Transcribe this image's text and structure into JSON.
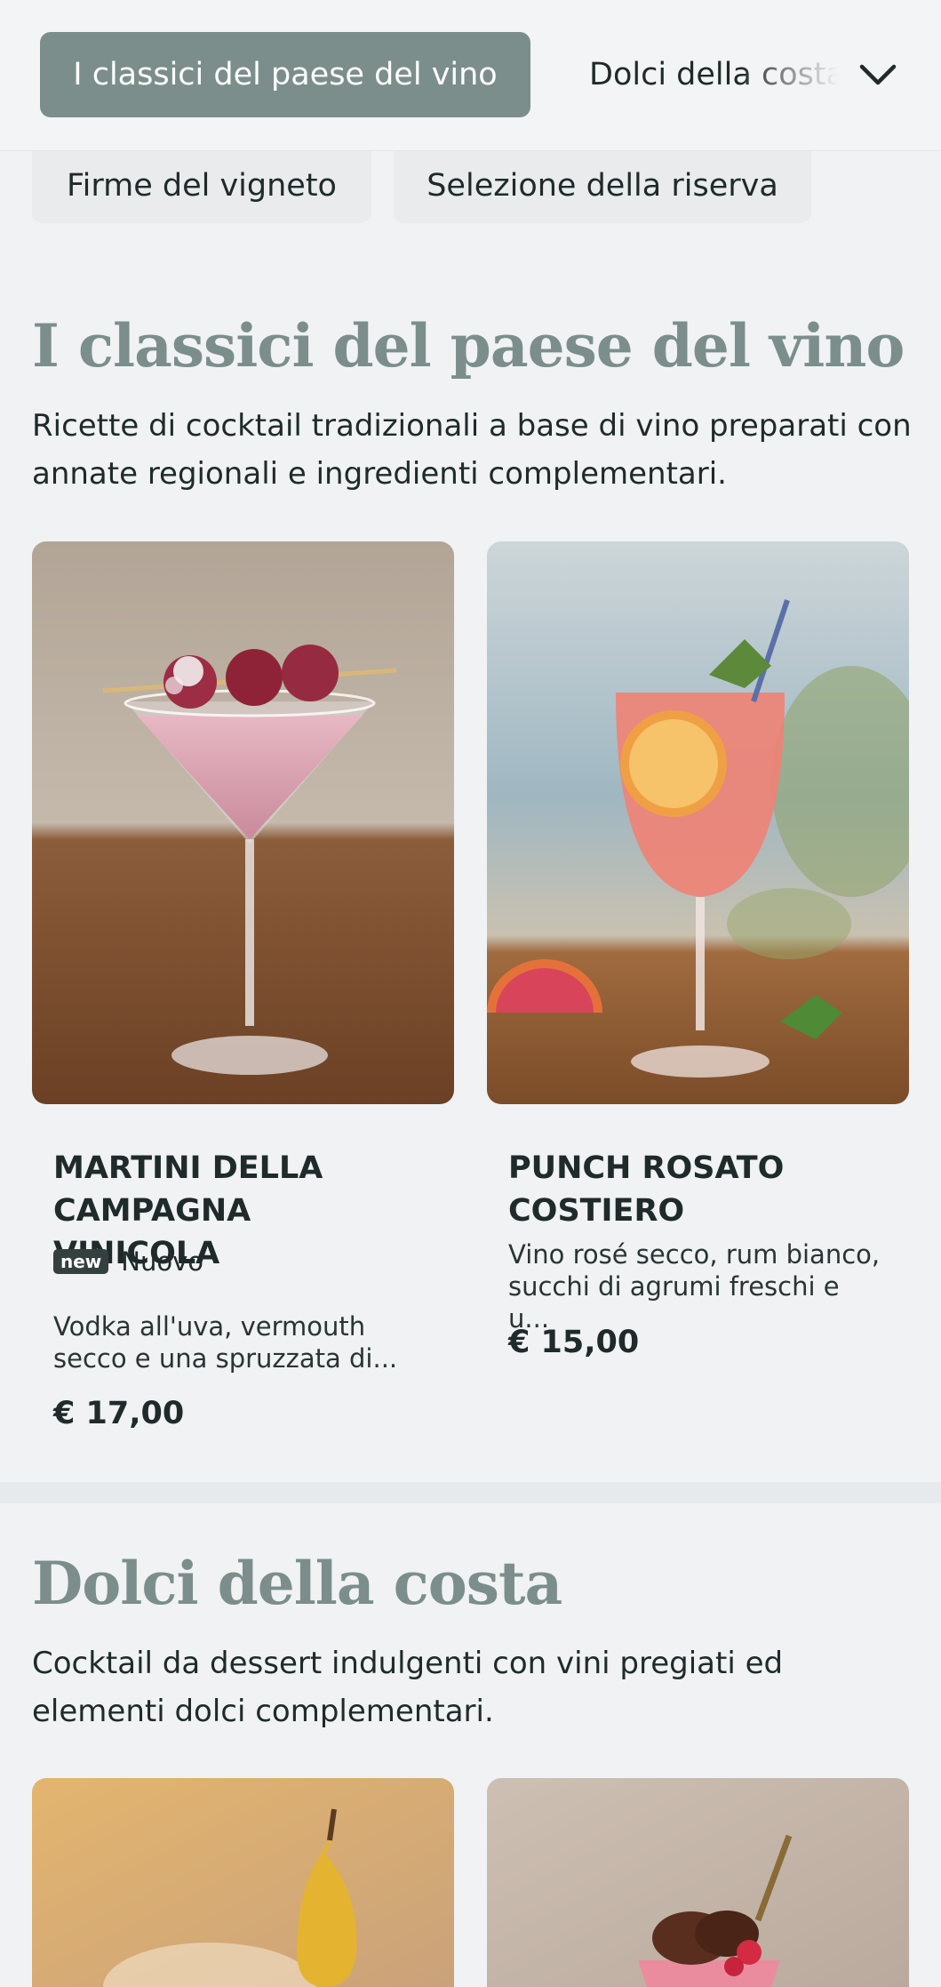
{
  "nav": {
    "active_tab": "I classici del paese del vino",
    "next_tab": "Dolci della costa",
    "chips": [
      "Firme del vigneto",
      "Selezione della riserva"
    ]
  },
  "sections": [
    {
      "title": "I classici del paese del vino",
      "description": "Ricette di cocktail tradizionali a base di vino preparati con annate regionali e ingredienti complementari.",
      "items": [
        {
          "name": "MARTINI DELLA CAMPAGNA VINICOLA",
          "badge": "new",
          "badge_label": "Nuovo",
          "description": "Vodka all'uva, vermouth secco e una spruzzata di...",
          "price": "€ 17,00"
        },
        {
          "name": "PUNCH ROSATO COSTIERO",
          "description": "Vino rosé secco, rum bianco, succhi di agrumi freschi e u...",
          "price": "€ 15,00"
        }
      ]
    },
    {
      "title": "Dolci della costa",
      "description": "Cocktail da dessert indulgenti con vini pregiati ed elementi dolci complementari."
    }
  ],
  "colors": {
    "accent": "#7b8e8b",
    "background": "#f0f2f4",
    "text": "#1f2a2a"
  }
}
